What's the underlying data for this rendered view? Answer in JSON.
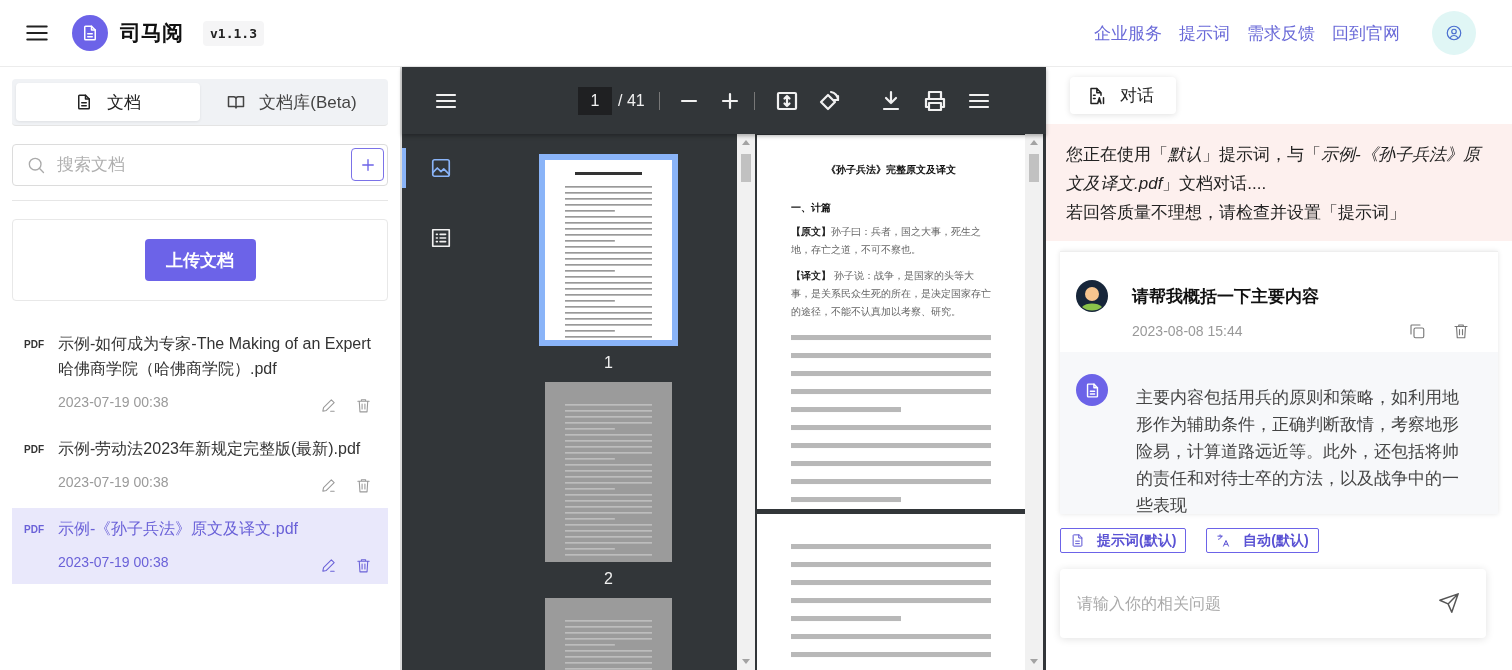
{
  "header": {
    "app_name": "司马阅",
    "version": "v1.1.3",
    "nav_links": [
      "企业服务",
      "提示词",
      "需求反馈",
      "回到官网"
    ]
  },
  "sidebar": {
    "tabs": [
      {
        "label": "文档",
        "kind": "file",
        "selected": true
      },
      {
        "label": "文档库(Beta)",
        "kind": "book",
        "selected": false
      }
    ],
    "search": {
      "placeholder": "搜索文档"
    },
    "upload_button": "上传文档",
    "documents": [
      {
        "badge": "PDF",
        "name": "示例-如何成为专家-The Making of an Expert哈佛商学院（哈佛商学院）.pdf",
        "date": "2023-07-19 00:38",
        "selected": false
      },
      {
        "badge": "PDF",
        "name": "示例-劳动法2023年新规定完整版(最新).pdf",
        "date": "2023-07-19 00:38",
        "selected": false
      },
      {
        "badge": "PDF",
        "name": "示例-《孙子兵法》原文及译文.pdf",
        "date": "2023-07-19 00:38",
        "selected": true
      }
    ]
  },
  "viewer": {
    "toolbar": {
      "page": "1",
      "page_total": "/ 41"
    },
    "side_views": [
      {
        "kind": "thumbnails",
        "selected": true
      },
      {
        "kind": "outline",
        "selected": false
      }
    ],
    "thumbnails": [
      {
        "label": "1",
        "selected": true,
        "rendered": true
      },
      {
        "label": "2",
        "selected": false,
        "rendered": false
      },
      {
        "selected": false,
        "rendered": false
      }
    ],
    "page": {
      "title": "《孙子兵法》完整原文及译文",
      "heading": "一、计篇",
      "paragraphs": [
        "**【原文】**孙子曰：兵者，国之大事，死生之地，存亡之道，不可不察也。",
        "**【译文】** 孙子说：战争，是国家的头等大事，是关系民众生死的所在，是决定国家存亡的途径，不能不认真加以考察、研究。"
      ]
    }
  },
  "chat": {
    "tab": "对话",
    "notice": [
      "您正在使用「*默认*」提示词，与「*示例-《孙子兵法》原文及译文.pdf*」文档对话....",
      "若回答质量不理想，请检查并设置「提示词」"
    ],
    "messages": [
      {
        "question": "请帮我概括一下主要内容",
        "time": "2023-08-08 15:44",
        "answer": "主要内容包括用兵的原则和策略，如利用地形作为辅助条件，正确判断敌情，考察地形险易，计算道路远近等。此外，还包括将帅的责任和对待士卒的方法，以及战争中的一些表现"
      }
    ],
    "chips": [
      {
        "kind": "prompt",
        "label": "提示词(默认)"
      },
      {
        "kind": "language",
        "label": "自动(默认)"
      }
    ],
    "input": {
      "placeholder": "请输入你的相关问题"
    }
  }
}
